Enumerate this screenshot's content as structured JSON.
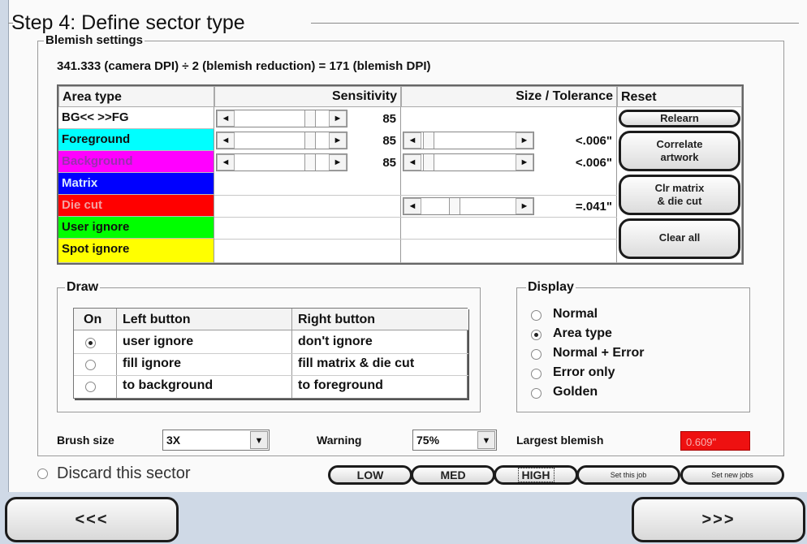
{
  "title": "Step 4: Define sector type",
  "blemish_settings": {
    "title": "Blemish settings",
    "formula": "341.333 (camera DPI) ÷ 2 (blemish reduction) = 171 (blemish DPI)",
    "headers": {
      "area_type": "Area type",
      "sensitivity": "Sensitivity",
      "size_tolerance": "Size / Tolerance",
      "reset": "Reset"
    },
    "rows": [
      {
        "label": "BG<< >>FG",
        "bg": "#ffffff",
        "fg": "#111111",
        "sensitivity": "85",
        "size": ""
      },
      {
        "label": "Foreground",
        "bg": "#00ffff",
        "fg": "#111111",
        "sensitivity": "85",
        "size": "<.006\""
      },
      {
        "label": "Background",
        "bg": "#ff00ff",
        "fg": "#9b2fb0",
        "sensitivity": "85",
        "size": "<.006\""
      },
      {
        "label": "Matrix",
        "bg": "#0000ff",
        "fg": "#d8e8ff",
        "sensitivity": "",
        "size": ""
      },
      {
        "label": "Die cut",
        "bg": "#ff0000",
        "fg": "#f3a0a0",
        "sensitivity": "",
        "size": "=.041\""
      },
      {
        "label": "User ignore",
        "bg": "#00ff00",
        "fg": "#111111",
        "sensitivity": "",
        "size": ""
      },
      {
        "label": "Spot ignore",
        "bg": "#ffff00",
        "fg": "#111111",
        "sensitivity": "",
        "size": ""
      }
    ],
    "reset_buttons": {
      "relearn": "Relearn",
      "correlate_1": "Correlate",
      "correlate_2": "artwork",
      "clr_1": "Clr matrix",
      "clr_2": "& die cut",
      "clear_all": "Clear all"
    }
  },
  "draw": {
    "title": "Draw",
    "headers": {
      "on": "On",
      "left": "Left button",
      "right": "Right button"
    },
    "rows": [
      {
        "left": "user ignore",
        "right": "don't ignore",
        "selected": true
      },
      {
        "left": "fill ignore",
        "right": "fill matrix & die cut",
        "selected": false
      },
      {
        "left": "to background",
        "right": "to foreground",
        "selected": false
      }
    ]
  },
  "display": {
    "title": "Display",
    "options": [
      "Normal",
      "Area type",
      "Normal + Error",
      "Error only",
      "Golden"
    ],
    "selected_index": 1
  },
  "bottom": {
    "brush_label": "Brush size",
    "brush_value": "3X",
    "warning_label": "Warning",
    "warning_value": "75%",
    "largest_label": "Largest blemish",
    "largest_value": "0.609\"",
    "largest_color": "#ee1111"
  },
  "discard_label": "Discard this sector",
  "level_buttons": [
    "LOW",
    "MED",
    "HIGH",
    "Set this job",
    "Set new jobs"
  ],
  "nav": {
    "back": "<<<",
    "next": ">>>"
  }
}
